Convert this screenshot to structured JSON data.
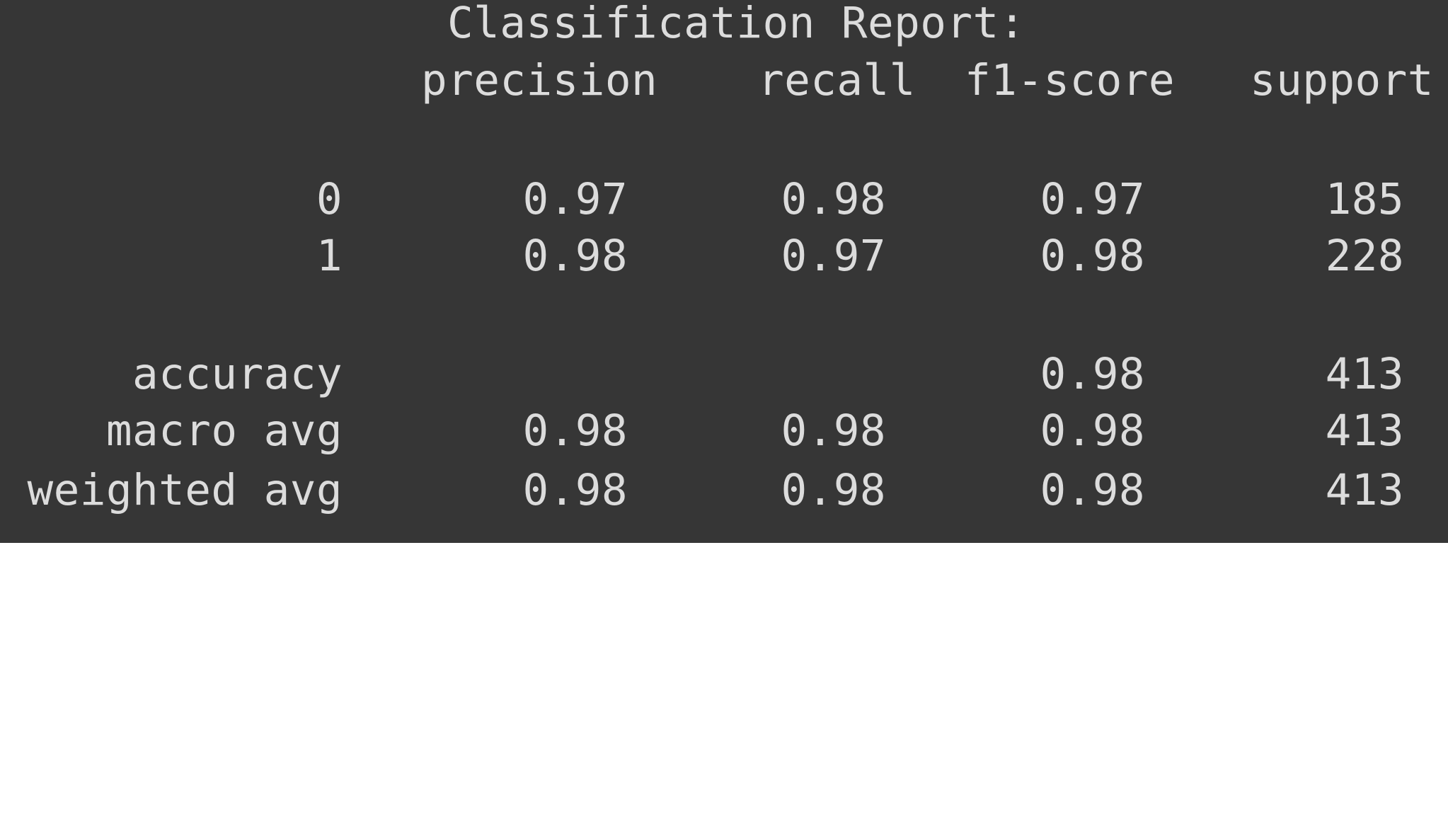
{
  "report": {
    "title": "Classification Report:",
    "headers": {
      "precision": "precision",
      "recall": "recall",
      "f1": "f1-score",
      "support": "support"
    },
    "classes": [
      {
        "label": "0",
        "precision": "0.97",
        "recall": "0.98",
        "f1": "0.97",
        "support": "185"
      },
      {
        "label": "1",
        "precision": "0.98",
        "recall": "0.97",
        "f1": "0.98",
        "support": "228"
      }
    ],
    "summary": [
      {
        "label": "accuracy",
        "precision": "",
        "recall": "",
        "f1": "0.98",
        "support": "413"
      },
      {
        "label": "macro avg",
        "precision": "0.98",
        "recall": "0.98",
        "f1": "0.98",
        "support": "413"
      },
      {
        "label": "weighted avg",
        "precision": "0.98",
        "recall": "0.98",
        "f1": "0.98",
        "support": "413"
      }
    ]
  },
  "colors": {
    "background": "#363636",
    "text": "#dcdcdc"
  }
}
